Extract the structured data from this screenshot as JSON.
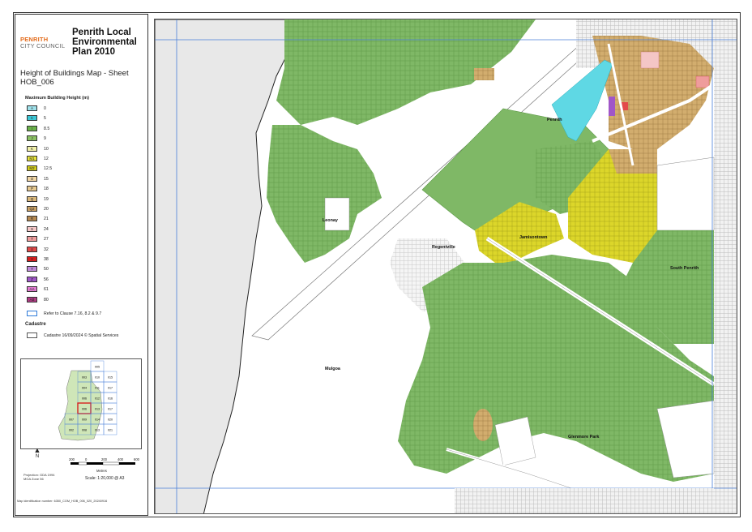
{
  "header": {
    "logo_line1": "PENRITH",
    "logo_line2": "CITY COUNCIL",
    "plan_title": "Penrith Local Environmental Plan 2010",
    "map_title": "Height of Buildings Map - Sheet HOB_006"
  },
  "legend": {
    "heading": "Maximum Building Height (m)",
    "items": [
      {
        "code": "A",
        "value": "0",
        "color": "#9fe1ea"
      },
      {
        "code": "C",
        "value": "5",
        "color": "#3cc7d6"
      },
      {
        "code": "I",
        "value": "8.5",
        "color": "#6bb24a"
      },
      {
        "code": "J",
        "value": "9",
        "color": "#8bc164"
      },
      {
        "code": "K",
        "value": "10",
        "color": "#f0f0a8"
      },
      {
        "code": "M1",
        "value": "12",
        "color": "#e6e33a"
      },
      {
        "code": "M2",
        "value": "12.5",
        "color": "#d4cf1c"
      },
      {
        "code": "O",
        "value": "15",
        "color": "#f1d6a4"
      },
      {
        "code": "P",
        "value": "18",
        "color": "#e7c98f"
      },
      {
        "code": "Q",
        "value": "19",
        "color": "#d9b77a"
      },
      {
        "code": "Q2",
        "value": "20",
        "color": "#cda467"
      },
      {
        "code": "R",
        "value": "21",
        "color": "#b88b52"
      },
      {
        "code": "S",
        "value": "24",
        "color": "#f4c6c6"
      },
      {
        "code": "T",
        "value": "27",
        "color": "#ef9c9c"
      },
      {
        "code": "U",
        "value": "32",
        "color": "#e34a4a"
      },
      {
        "code": "V",
        "value": "38",
        "color": "#d72020"
      },
      {
        "code": "Y",
        "value": "50",
        "color": "#bf8ad8"
      },
      {
        "code": "Z",
        "value": "56",
        "color": "#a056c8"
      },
      {
        "code": "AA",
        "value": "61",
        "color": "#e07ad0"
      },
      {
        "code": "AB",
        "value": "80",
        "color": "#b33c86"
      }
    ],
    "refer_label": "Refer to Clause 7.16, 8.2 & 9.7",
    "cadastre_heading": "Cadastre",
    "cadastre_label": "Cadastre 16/09/2024 © Spatial Services"
  },
  "keymap": {
    "sheets": [
      "005",
      "003",
      "010",
      "015",
      "004",
      "011",
      "017",
      "006",
      "012",
      "016",
      "006",
      "013",
      "017",
      "007",
      "009",
      "014",
      "020",
      "002",
      "008",
      "013",
      "021"
    ],
    "current": "006"
  },
  "footer": {
    "north": "N",
    "projection": "Projection: GDA 1994 MGA Zone 56",
    "scale_ticks": [
      "200",
      "0",
      "200",
      "400",
      "600"
    ],
    "scale_unit": "Metres",
    "scale": "Scale: 1:20,000 @ A3",
    "map_id": "Map identification number: 6350_COM_HOB_006_020_20240916"
  },
  "map": {
    "places": {
      "penrith": "Penrith",
      "leonay": "Leonay",
      "regentville": "Regentville",
      "jamisontown": "Jamisontown",
      "south_penrith": "South Penrith",
      "mulgoa": "Mulgoa",
      "glenmore_park": "Glenmore Park"
    },
    "colors": {
      "green": "#7fb866",
      "yellow": "#dcd62a",
      "tan": "#d2ad6e",
      "cyan": "#5fd8e4",
      "river": "#e8e8e8",
      "grid": "#4a7fd9"
    }
  }
}
